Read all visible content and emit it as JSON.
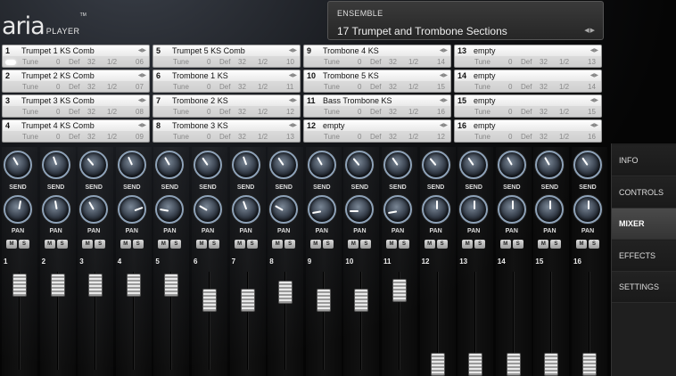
{
  "app": {
    "logo_text": "aria",
    "logo_sub": "PLAYER",
    "logo_tm": "TM"
  },
  "ensemble": {
    "label": "ENSEMBLE",
    "name": "17 Trumpet and Trombone Sections",
    "arrows": "◀▶"
  },
  "slot_fields": {
    "tune": "Tune",
    "tune_val": "0",
    "def": "Def",
    "def_val": "32",
    "half": "1/2",
    "arrows": "◀▶"
  },
  "slots": [
    {
      "num": "1",
      "name": "Trumpet 1 KS Comb",
      "ch": "06"
    },
    {
      "num": "2",
      "name": "Trumpet 2 KS Comb",
      "ch": "07"
    },
    {
      "num": "3",
      "name": "Trumpet 3 KS Comb",
      "ch": "08"
    },
    {
      "num": "4",
      "name": "Trumpet 4 KS Comb",
      "ch": "09"
    },
    {
      "num": "5",
      "name": "Trumpet 5 KS Comb",
      "ch": "10"
    },
    {
      "num": "6",
      "name": "Trombone 1 KS",
      "ch": "11"
    },
    {
      "num": "7",
      "name": "Trombone 2 KS",
      "ch": "12"
    },
    {
      "num": "8",
      "name": "Trombone 3 KS",
      "ch": "13"
    },
    {
      "num": "9",
      "name": "Trombone 4 KS",
      "ch": "14"
    },
    {
      "num": "10",
      "name": "Trombone 5 KS",
      "ch": "15"
    },
    {
      "num": "11",
      "name": "Bass Trombone KS",
      "ch": "16"
    },
    {
      "num": "12",
      "name": "empty",
      "ch": "12"
    },
    {
      "num": "13",
      "name": "empty",
      "ch": "13"
    },
    {
      "num": "14",
      "name": "empty",
      "ch": "14"
    },
    {
      "num": "15",
      "name": "empty",
      "ch": "15"
    },
    {
      "num": "16",
      "name": "empty",
      "ch": "16"
    }
  ],
  "mixer": {
    "send_label": "SEND",
    "pan_label": "PAN",
    "mute_label": "M",
    "solo_label": "S",
    "channels": [
      {
        "num": "1",
        "fader": 0.95
      },
      {
        "num": "2",
        "fader": 0.95
      },
      {
        "num": "3",
        "fader": 0.95
      },
      {
        "num": "4",
        "fader": 0.95
      },
      {
        "num": "5",
        "fader": 0.95
      },
      {
        "num": "6",
        "fader": 0.78
      },
      {
        "num": "7",
        "fader": 0.78
      },
      {
        "num": "8",
        "fader": 0.87
      },
      {
        "num": "9",
        "fader": 0.78
      },
      {
        "num": "10",
        "fader": 0.78
      },
      {
        "num": "11",
        "fader": 0.89
      },
      {
        "num": "12",
        "fader": 0.08
      },
      {
        "num": "13",
        "fader": 0.08
      },
      {
        "num": "14",
        "fader": 0.08
      },
      {
        "num": "15",
        "fader": 0.08
      },
      {
        "num": "16",
        "fader": 0.08
      }
    ]
  },
  "menu": {
    "items": [
      {
        "label": "INFO",
        "active": false
      },
      {
        "label": "CONTROLS",
        "active": false
      },
      {
        "label": "MIXER",
        "active": true
      },
      {
        "label": "EFFECTS",
        "active": false
      },
      {
        "label": "SETTINGS",
        "active": false
      }
    ]
  }
}
